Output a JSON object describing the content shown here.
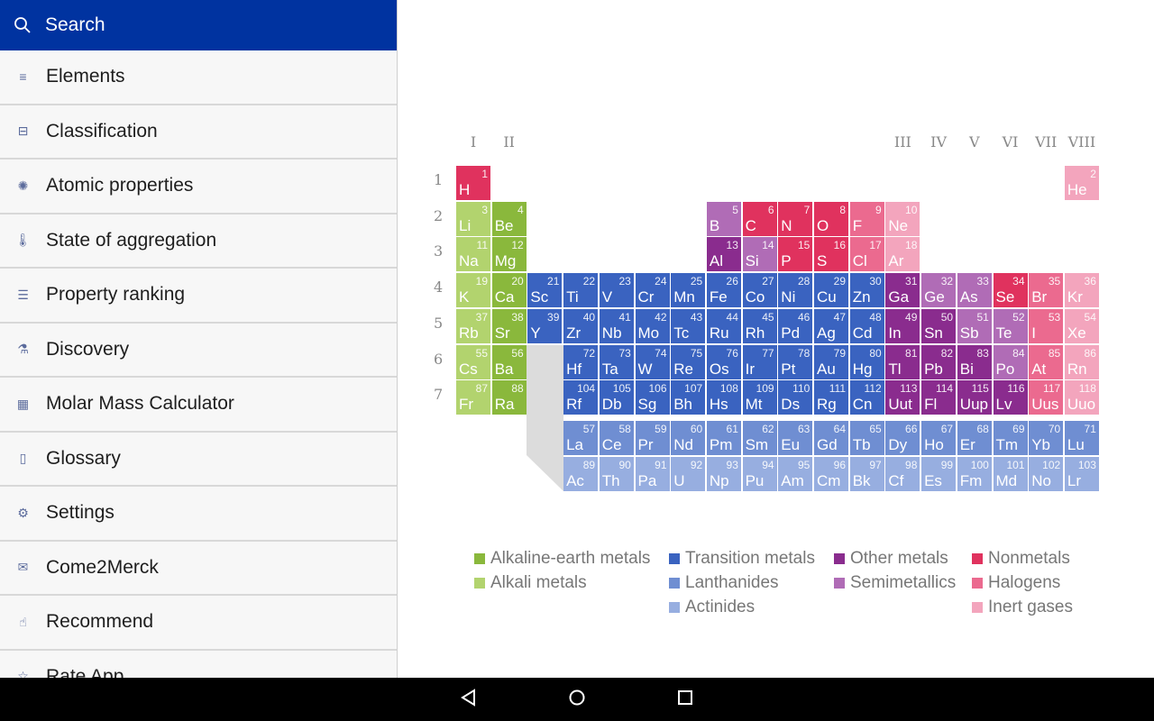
{
  "sidebar": {
    "search_label": "Search",
    "items": [
      {
        "label": "Elements",
        "icon": "list-icon"
      },
      {
        "label": "Classification",
        "icon": "tray-icon"
      },
      {
        "label": "Atomic properties",
        "icon": "atom-icon"
      },
      {
        "label": "State of aggregation",
        "icon": "thermometer-icon"
      },
      {
        "label": "Property ranking",
        "icon": "ranking-icon"
      },
      {
        "label": "Discovery",
        "icon": "microscope-icon"
      },
      {
        "label": "Molar Mass Calculator",
        "icon": "calculator-icon"
      },
      {
        "label": "Glossary",
        "icon": "book-icon"
      },
      {
        "label": "Settings",
        "icon": "gear-icon"
      },
      {
        "label": "Come2Merck",
        "icon": "briefcase-icon"
      },
      {
        "label": "Recommend",
        "icon": "thumbs-up-icon"
      },
      {
        "label": "Rate App",
        "icon": "star-icon"
      }
    ]
  },
  "table": {
    "groups": [
      {
        "label": "I",
        "col": 1
      },
      {
        "label": "II",
        "col": 2
      },
      {
        "label": "III",
        "col": 13
      },
      {
        "label": "IV",
        "col": 14
      },
      {
        "label": "V",
        "col": 15
      },
      {
        "label": "VI",
        "col": 16
      },
      {
        "label": "VII",
        "col": 17
      },
      {
        "label": "VIII",
        "col": 18
      }
    ],
    "periods": [
      "1",
      "2",
      "3",
      "4",
      "5",
      "6",
      "7"
    ],
    "colors": {
      "ae": "#8ab83c",
      "ak": "#b2d36e",
      "tm": "#3a63c0",
      "om": "#8a2c8e",
      "sm": "#b06cb6",
      "nm": "#e0325e",
      "ha": "#eb6a8f",
      "ig": "#f3a5bd",
      "la": "#6f8ed2",
      "ac": "#97aee0"
    },
    "elements": [
      [
        "H",
        "nm"
      ],
      [
        "He",
        "ig"
      ],
      [
        "Li",
        "ak"
      ],
      [
        "Be",
        "ae"
      ],
      [
        "B",
        "sm"
      ],
      [
        "C",
        "nm"
      ],
      [
        "N",
        "nm"
      ],
      [
        "O",
        "nm"
      ],
      [
        "F",
        "ha"
      ],
      [
        "Ne",
        "ig"
      ],
      [
        "Na",
        "ak"
      ],
      [
        "Mg",
        "ae"
      ],
      [
        "Al",
        "om"
      ],
      [
        "Si",
        "sm"
      ],
      [
        "P",
        "nm"
      ],
      [
        "S",
        "nm"
      ],
      [
        "Cl",
        "ha"
      ],
      [
        "Ar",
        "ig"
      ],
      [
        "K",
        "ak"
      ],
      [
        "Ca",
        "ae"
      ],
      [
        "Sc",
        "tm"
      ],
      [
        "Ti",
        "tm"
      ],
      [
        "V",
        "tm"
      ],
      [
        "Cr",
        "tm"
      ],
      [
        "Mn",
        "tm"
      ],
      [
        "Fe",
        "tm"
      ],
      [
        "Co",
        "tm"
      ],
      [
        "Ni",
        "tm"
      ],
      [
        "Cu",
        "tm"
      ],
      [
        "Zn",
        "tm"
      ],
      [
        "Ga",
        "om"
      ],
      [
        "Ge",
        "sm"
      ],
      [
        "As",
        "sm"
      ],
      [
        "Se",
        "nm"
      ],
      [
        "Br",
        "ha"
      ],
      [
        "Kr",
        "ig"
      ],
      [
        "Rb",
        "ak"
      ],
      [
        "Sr",
        "ae"
      ],
      [
        "Y",
        "tm"
      ],
      [
        "Zr",
        "tm"
      ],
      [
        "Nb",
        "tm"
      ],
      [
        "Mo",
        "tm"
      ],
      [
        "Tc",
        "tm"
      ],
      [
        "Ru",
        "tm"
      ],
      [
        "Rh",
        "tm"
      ],
      [
        "Pd",
        "tm"
      ],
      [
        "Ag",
        "tm"
      ],
      [
        "Cd",
        "tm"
      ],
      [
        "In",
        "om"
      ],
      [
        "Sn",
        "om"
      ],
      [
        "Sb",
        "sm"
      ],
      [
        "Te",
        "sm"
      ],
      [
        "I",
        "ha"
      ],
      [
        "Xe",
        "ig"
      ],
      [
        "Cs",
        "ak"
      ],
      [
        "Ba",
        "ae"
      ],
      [
        "La",
        "la"
      ],
      [
        "Ce",
        "la"
      ],
      [
        "Pr",
        "la"
      ],
      [
        "Nd",
        "la"
      ],
      [
        "Pm",
        "la"
      ],
      [
        "Sm",
        "la"
      ],
      [
        "Eu",
        "la"
      ],
      [
        "Gd",
        "la"
      ],
      [
        "Tb",
        "la"
      ],
      [
        "Dy",
        "la"
      ],
      [
        "Ho",
        "la"
      ],
      [
        "Er",
        "la"
      ],
      [
        "Tm",
        "la"
      ],
      [
        "Yb",
        "la"
      ],
      [
        "Lu",
        "la"
      ],
      [
        "Hf",
        "tm"
      ],
      [
        "Ta",
        "tm"
      ],
      [
        "W",
        "tm"
      ],
      [
        "Re",
        "tm"
      ],
      [
        "Os",
        "tm"
      ],
      [
        "Ir",
        "tm"
      ],
      [
        "Pt",
        "tm"
      ],
      [
        "Au",
        "tm"
      ],
      [
        "Hg",
        "tm"
      ],
      [
        "Tl",
        "om"
      ],
      [
        "Pb",
        "om"
      ],
      [
        "Bi",
        "om"
      ],
      [
        "Po",
        "sm"
      ],
      [
        "At",
        "ha"
      ],
      [
        "Rn",
        "ig"
      ],
      [
        "Fr",
        "ak"
      ],
      [
        "Ra",
        "ae"
      ],
      [
        "Ac",
        "ac"
      ],
      [
        "Th",
        "ac"
      ],
      [
        "Pa",
        "ac"
      ],
      [
        "U",
        "ac"
      ],
      [
        "Np",
        "ac"
      ],
      [
        "Pu",
        "ac"
      ],
      [
        "Am",
        "ac"
      ],
      [
        "Cm",
        "ac"
      ],
      [
        "Bk",
        "ac"
      ],
      [
        "Cf",
        "ac"
      ],
      [
        "Es",
        "ac"
      ],
      [
        "Fm",
        "ac"
      ],
      [
        "Md",
        "ac"
      ],
      [
        "No",
        "ac"
      ],
      [
        "Lr",
        "ac"
      ],
      [
        "Rf",
        "tm"
      ],
      [
        "Db",
        "tm"
      ],
      [
        "Sg",
        "tm"
      ],
      [
        "Bh",
        "tm"
      ],
      [
        "Hs",
        "tm"
      ],
      [
        "Mt",
        "tm"
      ],
      [
        "Ds",
        "tm"
      ],
      [
        "Rg",
        "tm"
      ],
      [
        "Cn",
        "tm"
      ],
      [
        "Uut",
        "om"
      ],
      [
        "Fl",
        "om"
      ],
      [
        "Uup",
        "om"
      ],
      [
        "Lv",
        "om"
      ],
      [
        "Uus",
        "ha"
      ],
      [
        "Uuo",
        "ig"
      ]
    ]
  },
  "legend": [
    {
      "label": "Alkaline-earth metals",
      "cat": "ae"
    },
    {
      "label": "Alkali metals",
      "cat": "ak"
    },
    {
      "label": "Transition metals",
      "cat": "tm"
    },
    {
      "label": "Lanthanides",
      "cat": "la"
    },
    {
      "label": "Actinides",
      "cat": "ac"
    },
    {
      "label": "Other metals",
      "cat": "om"
    },
    {
      "label": "Semimetallics",
      "cat": "sm"
    },
    {
      "label": "Nonmetals",
      "cat": "nm"
    },
    {
      "label": "Halogens",
      "cat": "ha"
    },
    {
      "label": "Inert gases",
      "cat": "ig"
    }
  ],
  "navbar": {
    "back": "back-icon",
    "home": "home-icon",
    "recents": "recents-icon"
  }
}
